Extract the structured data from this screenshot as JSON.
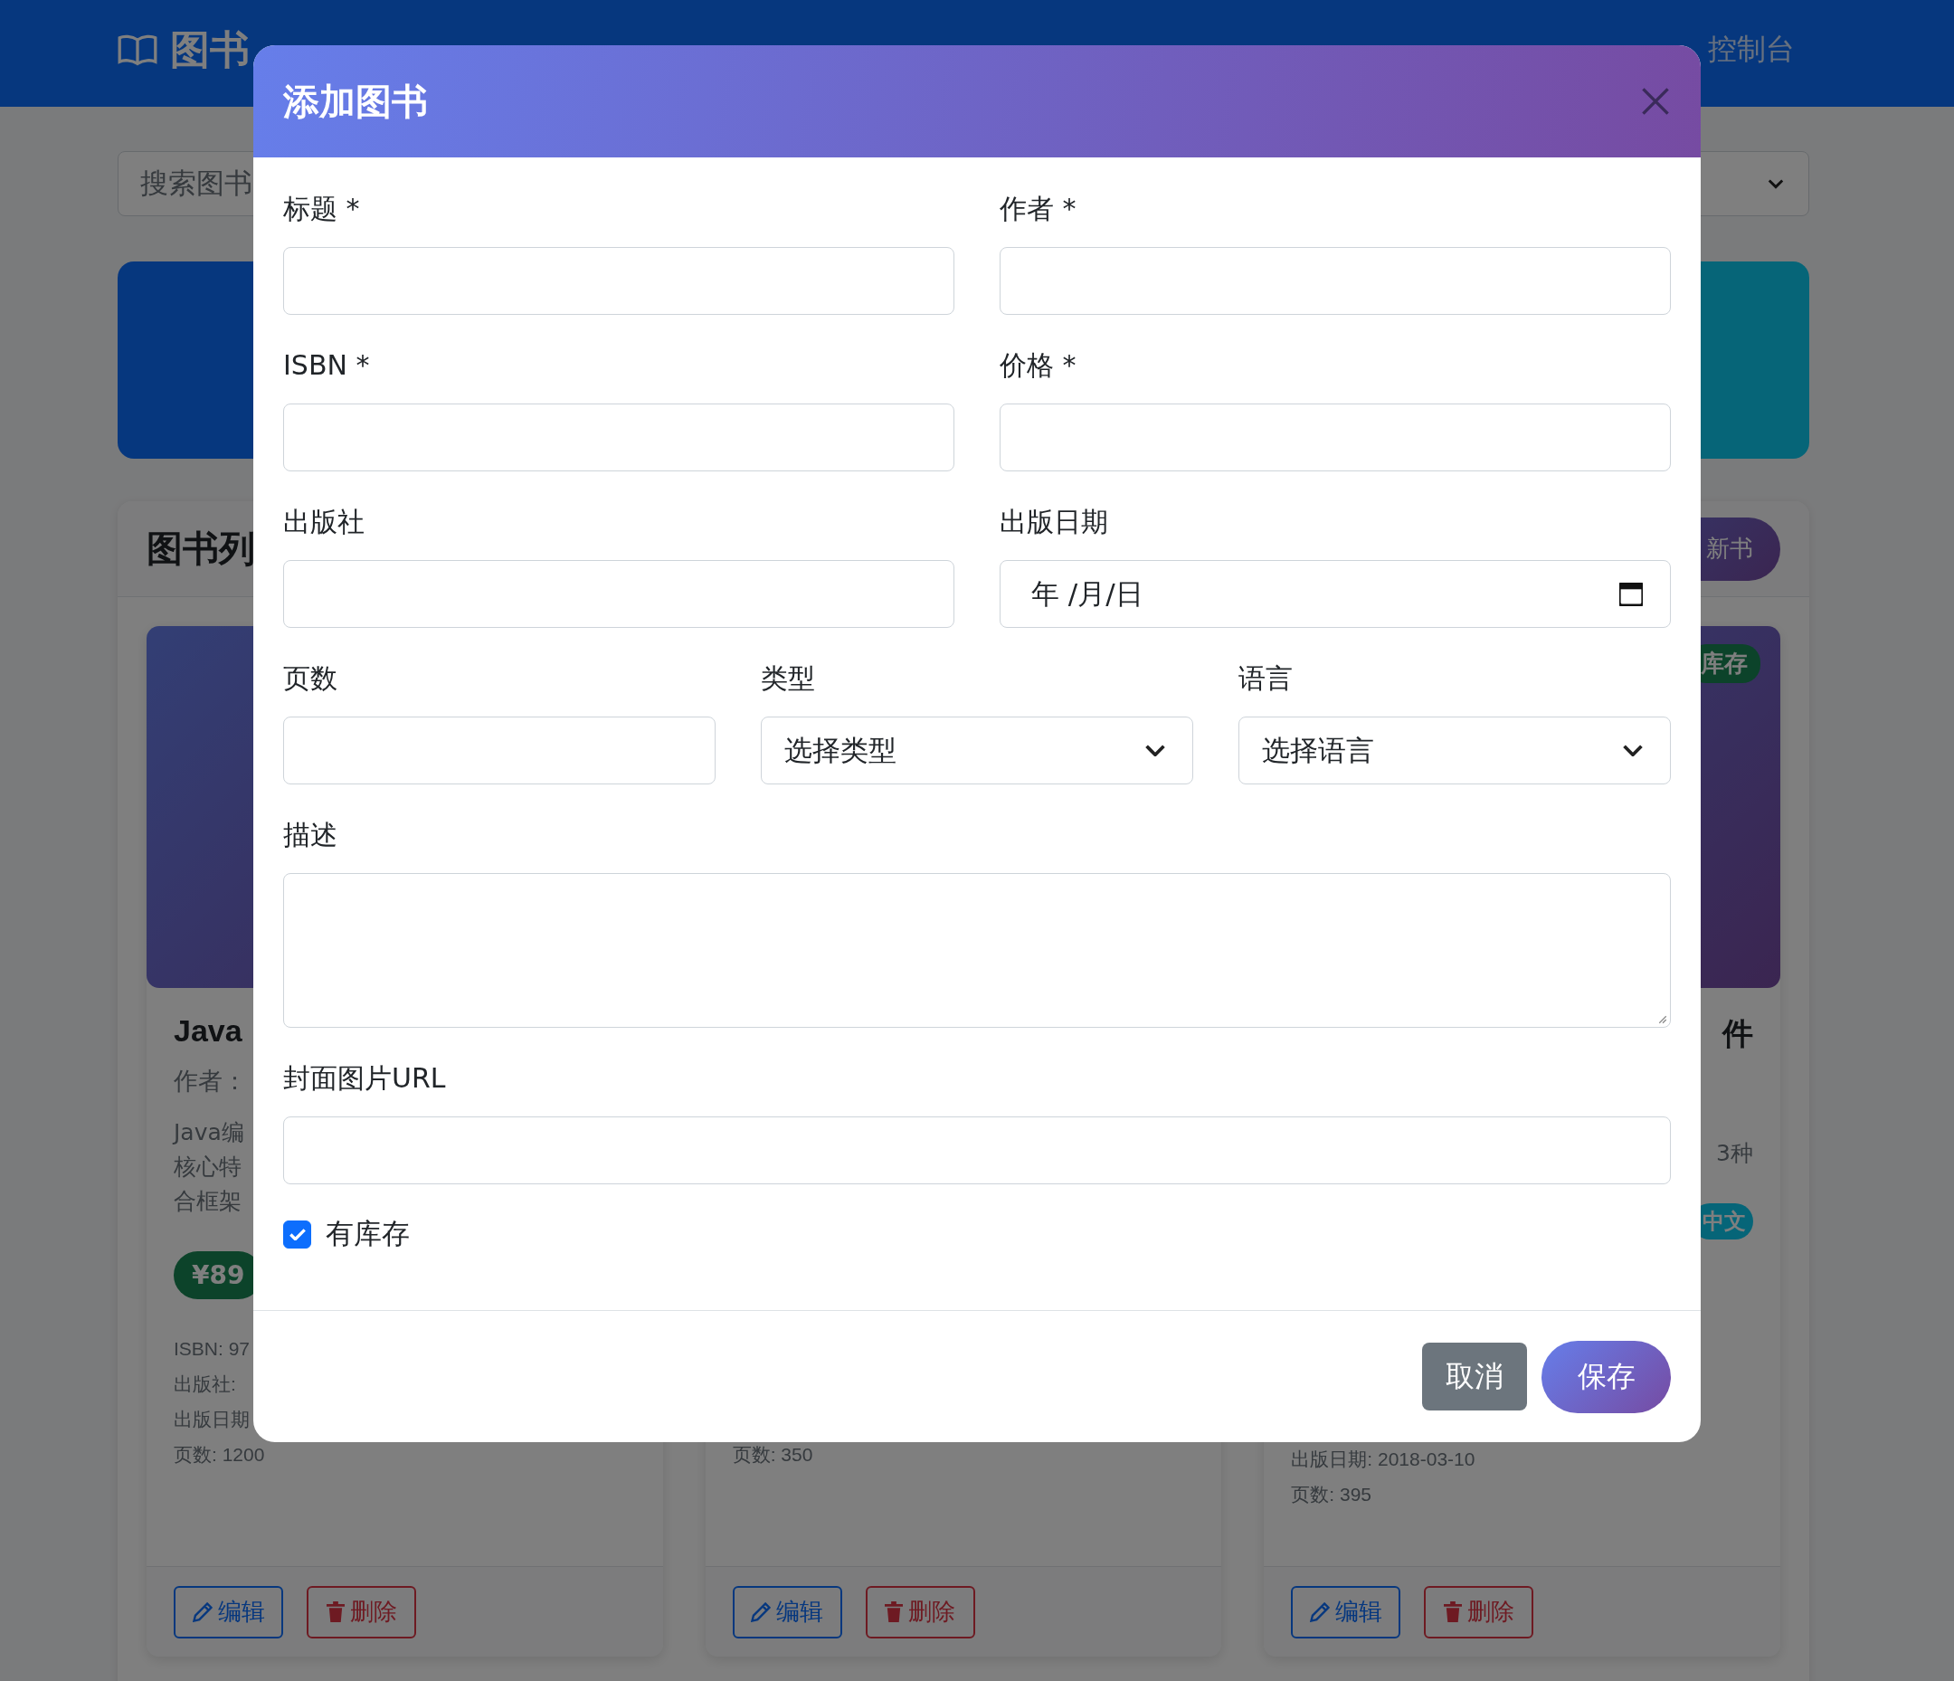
{
  "navbar": {
    "brand": "图书",
    "links": [
      {
        "label": "控制台"
      }
    ]
  },
  "search": {
    "placeholder": "搜索图书"
  },
  "book_list": {
    "title": "图书列",
    "add_button": "新书",
    "books": [
      {
        "title": "Java",
        "author": "作者：",
        "description": [
          "Java编",
          "核心特",
          "合框架"
        ],
        "price": "¥89",
        "details": [
          "ISBN: 97",
          "出版社:",
          "出版日期",
          "页数: 1200"
        ],
        "actions": [
          "编辑",
          "删除"
        ]
      },
      {
        "details": [
          "页数: 350"
        ],
        "actions": [
          "编辑",
          "删除"
        ]
      },
      {
        "title": "件",
        "description": [
          "3种"
        ],
        "language": "中文",
        "stock": "库存",
        "details": [
          "出版日期: 2018-03-10",
          "页数: 395"
        ],
        "actions": [
          "编辑",
          "删除"
        ]
      }
    ]
  },
  "modal": {
    "title": "添加图书",
    "rows": [
      {
        "fields": [
          {
            "label": "标题 *",
            "kind": "text"
          },
          {
            "label": "作者 *",
            "kind": "text"
          }
        ]
      },
      {
        "fields": [
          {
            "label": "ISBN *",
            "kind": "text"
          },
          {
            "label": "价格 *",
            "kind": "text"
          }
        ]
      },
      {
        "fields": [
          {
            "label": "出版社",
            "kind": "text"
          },
          {
            "label": "出版日期",
            "kind": "date",
            "placeholder": "年 /月/日"
          }
        ]
      },
      {
        "fields": [
          {
            "label": "页数",
            "kind": "text"
          },
          {
            "label": "类型",
            "kind": "select",
            "value": "选择类型"
          },
          {
            "label": "语言",
            "kind": "select",
            "value": "选择语言"
          }
        ]
      },
      {
        "fields": [
          {
            "label": "描述",
            "kind": "textarea"
          }
        ]
      },
      {
        "fields": [
          {
            "label": "封面图片URL",
            "kind": "text"
          }
        ]
      }
    ],
    "checkbox": {
      "label": "有库存",
      "checked": true
    },
    "buttons": [
      {
        "label": "取消",
        "kind": "secondary"
      },
      {
        "label": "保存",
        "kind": "primary"
      }
    ]
  }
}
